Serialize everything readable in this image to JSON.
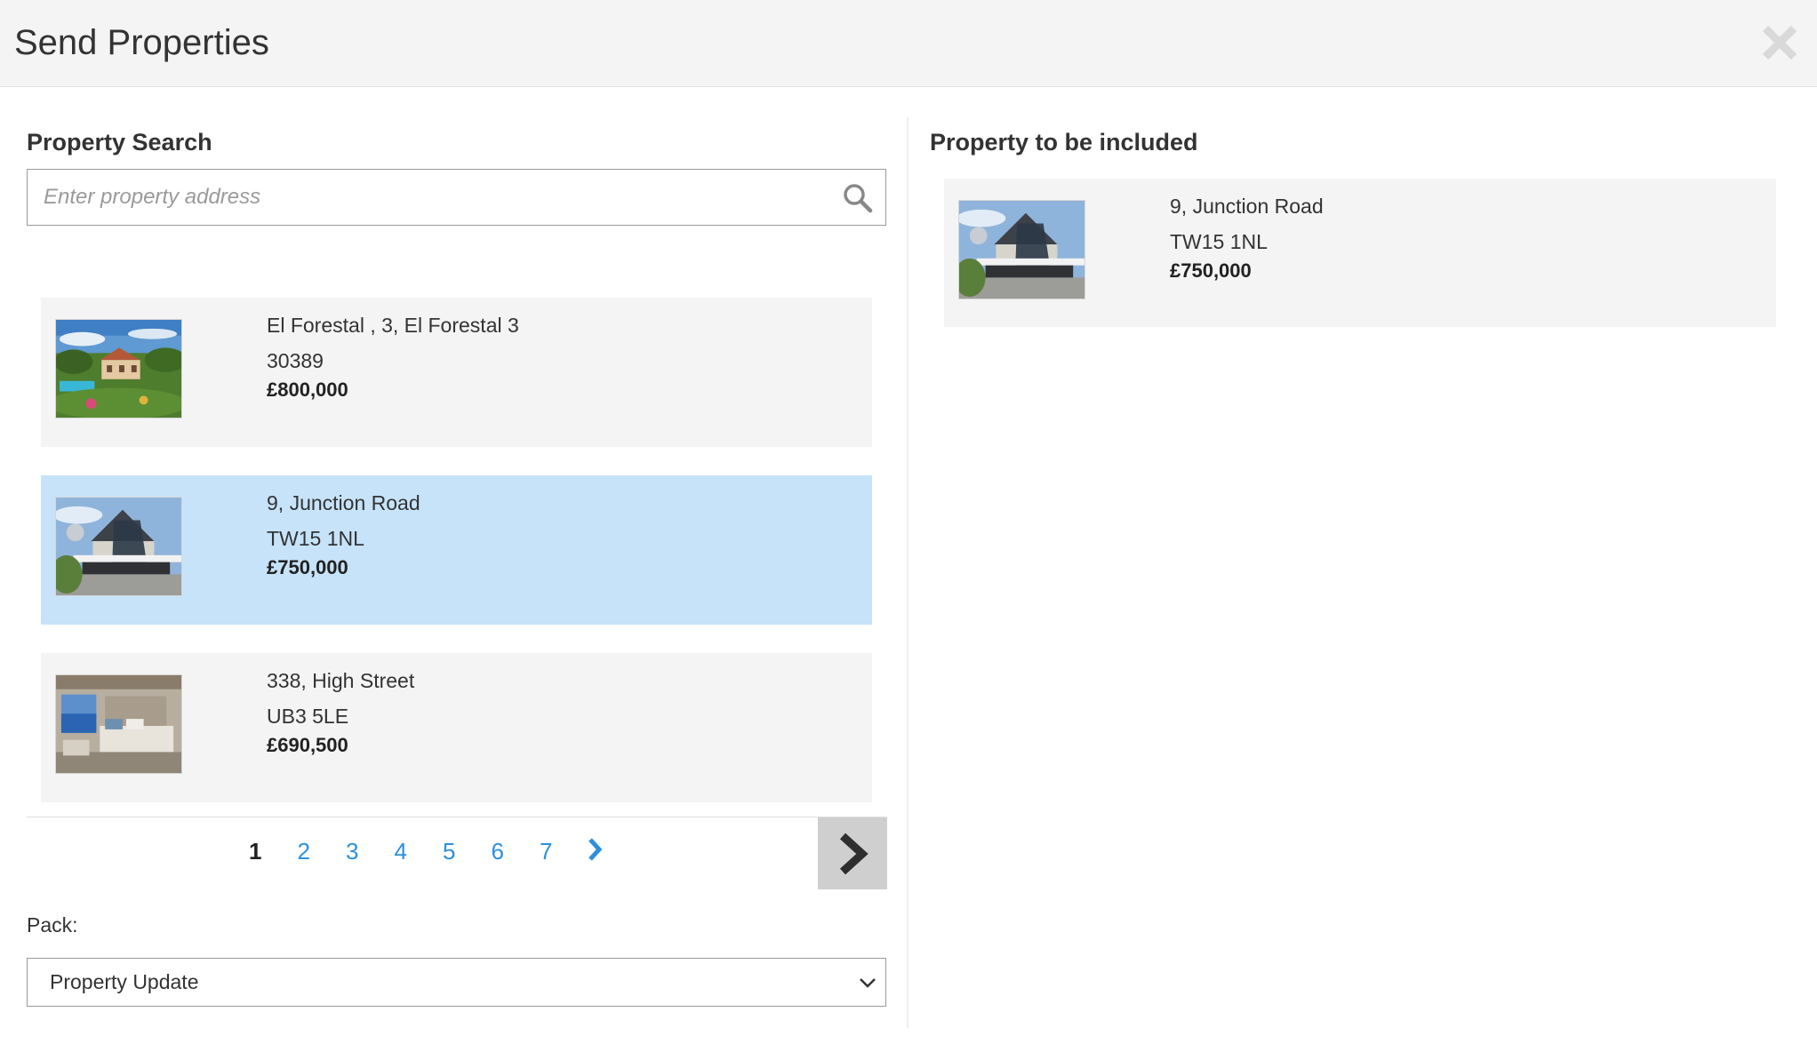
{
  "header": {
    "title": "Send Properties",
    "close_icon": "close-icon"
  },
  "search": {
    "title": "Property Search",
    "placeholder": "Enter property address",
    "value": "",
    "icon": "search-icon"
  },
  "results": [
    {
      "address": "El Forestal , 3, El Forestal 3",
      "postcode": "30389",
      "price": "£800,000",
      "selected": false,
      "image": "villa-with-pool-photo"
    },
    {
      "address": "9, Junction Road",
      "postcode": "TW15 1NL",
      "price": "£750,000",
      "selected": true,
      "image": "modern-house-photo"
    },
    {
      "address": "338, High Street",
      "postcode": "UB3 5LE",
      "price": "£690,500",
      "selected": false,
      "image": "bedroom-sea-view-photo"
    }
  ],
  "pagination": {
    "current": "1",
    "pages": [
      "1",
      "2",
      "3",
      "4",
      "5",
      "6",
      "7"
    ],
    "next_icon": "chevron-right-icon"
  },
  "pack": {
    "label": "Pack:",
    "value": "Property Update",
    "icon": "chevron-down-icon"
  },
  "included": {
    "title": "Property to be included",
    "items": [
      {
        "address": "9, Junction Road",
        "postcode": "TW15 1NL",
        "price": "£750,000",
        "image": "modern-house-photo"
      }
    ]
  },
  "colors": {
    "accent": "#2b8fe0",
    "selected_bg": "#c6e3fa",
    "card_bg": "#f4f4f4",
    "header_bg": "#f4f4f4"
  }
}
